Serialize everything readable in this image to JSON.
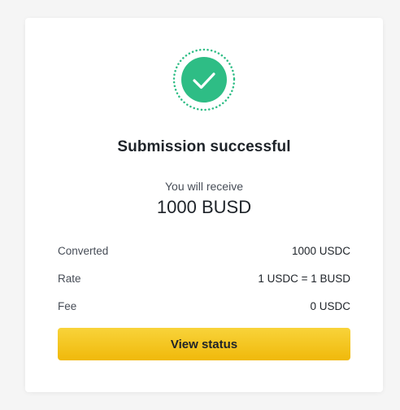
{
  "colors": {
    "success_green": "#2ebd85",
    "button_yellow": "#f0b90b",
    "text_primary": "#1e2329",
    "text_secondary": "#474d57"
  },
  "result": {
    "icon": "check-circle-icon",
    "title": "Submission successful",
    "receive_label": "You will receive",
    "receive_amount": "1000 BUSD"
  },
  "details": [
    {
      "label": "Converted",
      "value": "1000 USDC"
    },
    {
      "label": "Rate",
      "value": "1 USDC = 1 BUSD"
    },
    {
      "label": "Fee",
      "value": "0 USDC"
    }
  ],
  "button": {
    "label": "View status"
  }
}
